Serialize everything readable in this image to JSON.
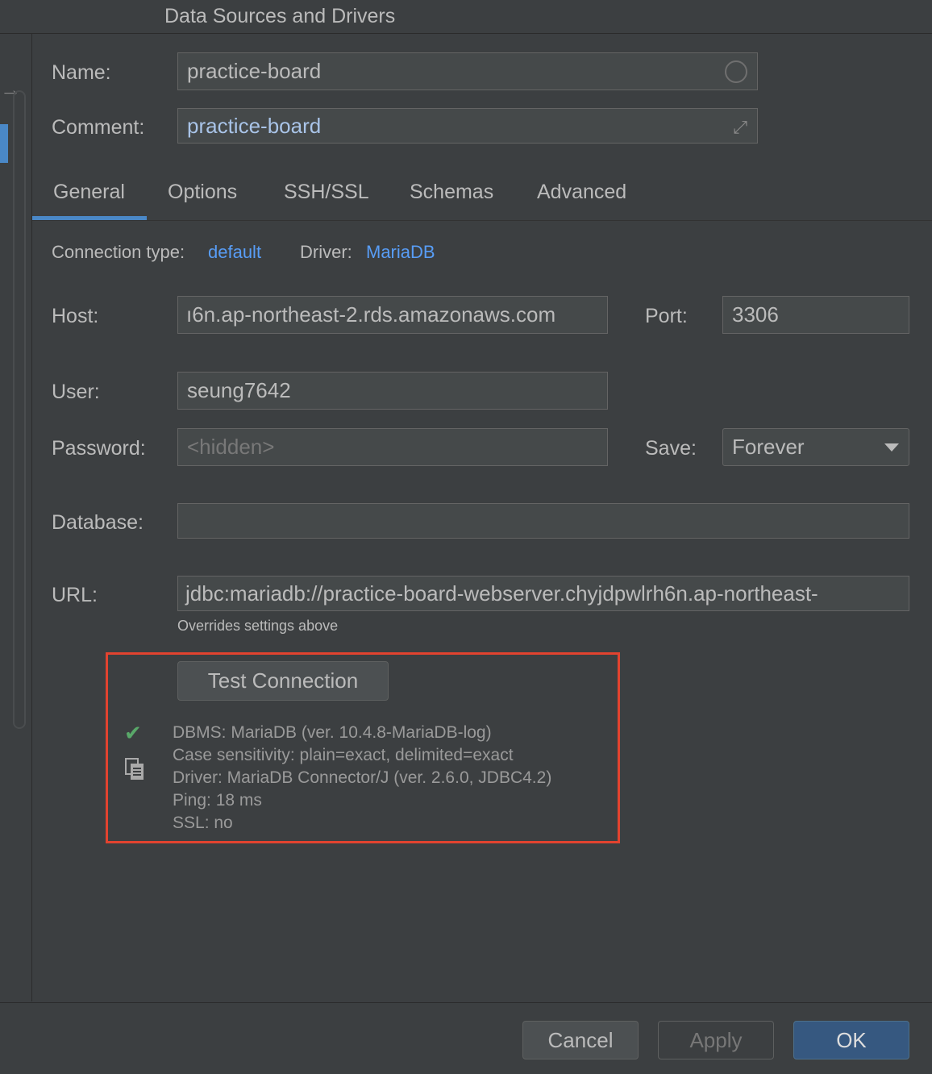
{
  "window": {
    "title": "Data Sources and Drivers"
  },
  "name": {
    "label": "Name:",
    "value": "practice-board"
  },
  "comment": {
    "label": "Comment:",
    "value": "practice-board"
  },
  "tabs": [
    "General",
    "Options",
    "SSH/SSL",
    "Schemas",
    "Advanced"
  ],
  "active_tab": "General",
  "connection": {
    "type_label": "Connection type:",
    "type_value": "default",
    "driver_label": "Driver:",
    "driver_value": "MariaDB"
  },
  "host": {
    "label": "Host:",
    "value": "ı6n.ap-northeast-2.rds.amazonaws.com"
  },
  "port": {
    "label": "Port:",
    "value": "3306"
  },
  "user": {
    "label": "User:",
    "value": "seung7642"
  },
  "password": {
    "label": "Password:",
    "placeholder": "<hidden>"
  },
  "save": {
    "label": "Save:",
    "value": "Forever"
  },
  "database": {
    "label": "Database:",
    "value": ""
  },
  "url": {
    "label": "URL:",
    "value": "jdbc:mariadb://practice-board-webserver.chyjdpwlrh6n.ap-northeast-",
    "hint": "Overrides settings above"
  },
  "test": {
    "button_label": "Test Connection",
    "results": [
      "DBMS: MariaDB (ver. 10.4.8-MariaDB-log)",
      "Case sensitivity: plain=exact, delimited=exact",
      "Driver: MariaDB Connector/J (ver. 2.6.0, JDBC4.2)",
      "Ping: 18 ms",
      "SSL: no"
    ]
  },
  "footer": {
    "cancel": "Cancel",
    "apply": "Apply",
    "ok": "OK"
  },
  "colors": {
    "accent": "#4a88c7",
    "link": "#589df6",
    "highlight_box": "#e2432f",
    "success": "#59a869"
  }
}
